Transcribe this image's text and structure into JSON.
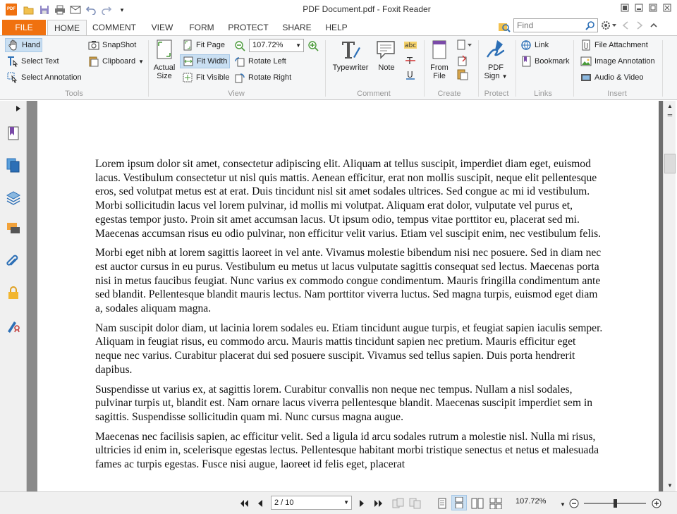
{
  "window": {
    "title": "PDF Document.pdf - Foxit Reader",
    "app_icon_text": "PDF"
  },
  "quick_access": [
    {
      "name": "open-icon"
    },
    {
      "name": "save-icon"
    },
    {
      "name": "print-icon"
    },
    {
      "name": "email-icon"
    },
    {
      "name": "undo-icon"
    },
    {
      "name": "redo-icon"
    },
    {
      "name": "customize-icon"
    }
  ],
  "tabs": {
    "file": "FILE",
    "home": "HOME",
    "comment": "COMMENT",
    "view": "VIEW",
    "form": "FORM",
    "protect": "PROTECT",
    "share": "SHARE",
    "help": "HELP"
  },
  "search": {
    "placeholder": "Find"
  },
  "ribbon": {
    "tools": {
      "hand": "Hand",
      "select_text": "Select Text",
      "select_annotation": "Select Annotation",
      "snapshot": "SnapShot",
      "clipboard": "Clipboard",
      "label": "Tools"
    },
    "view": {
      "actual_size_1": "Actual",
      "actual_size_2": "Size",
      "fit_page": "Fit Page",
      "fit_width": "Fit Width",
      "fit_visible": "Fit Visible",
      "zoom": "107.72%",
      "rotate_left": "Rotate Left",
      "rotate_right": "Rotate Right",
      "label": "View"
    },
    "comment": {
      "typewriter": "Typewriter",
      "note": "Note",
      "label": "Comment"
    },
    "create": {
      "from_file_1": "From",
      "from_file_2": "File",
      "label": "Create"
    },
    "protect": {
      "pdf_sign_1": "PDF",
      "pdf_sign_2": "Sign",
      "label": "Protect"
    },
    "links": {
      "link": "Link",
      "bookmark": "Bookmark",
      "label": "Links"
    },
    "insert": {
      "file_attachment": "File Attachment",
      "image_annotation": "Image Annotation",
      "audio_video": "Audio & Video",
      "label": "Insert"
    }
  },
  "document": {
    "paragraphs": [
      "Lorem ipsum dolor sit amet, consectetur adipiscing elit. Aliquam at tellus suscipit, imperdiet diam eget, euismod lacus. Vestibulum consectetur ut nisl quis mattis. Aenean efficitur, erat non mollis suscipit, neque elit pellentesque eros, sed volutpat metus est at erat. Duis tincidunt nisl sit amet sodales ultrices. Sed congue ac mi id vestibulum. Morbi sollicitudin lacus vel lorem pulvinar, id mollis mi volutpat. Aliquam erat dolor, vulputate vel purus et, egestas tempor justo. Proin sit amet accumsan lacus. Ut ipsum odio, tempus vitae porttitor eu, placerat sed mi. Maecenas accumsan risus eu odio pulvinar, non efficitur velit varius. Etiam vel suscipit enim, nec vestibulum felis.",
      "Morbi eget nibh at lorem sagittis laoreet in vel ante. Vivamus molestie bibendum nisi nec posuere. Sed in diam nec est auctor cursus in eu purus. Vestibulum eu metus ut lacus vulputate sagittis consequat sed lectus. Maecenas porta nisi in metus faucibus feugiat. Nunc varius ex commodo congue condimentum. Mauris fringilla condimentum ante sed blandit. Pellentesque blandit mauris lectus. Nam porttitor viverra luctus. Sed magna turpis, euismod eget diam a, sodales aliquam magna.",
      "Nam suscipit dolor diam, ut lacinia lorem sodales eu. Etiam tincidunt augue turpis, et feugiat sapien iaculis semper. Aliquam in feugiat risus, eu commodo arcu. Mauris mattis tincidunt sapien nec pretium. Mauris efficitur eget neque nec varius. Curabitur placerat dui sed posuere suscipit. Vivamus sed tellus sapien. Duis porta hendrerit dapibus.",
      "Suspendisse ut varius ex, at sagittis lorem. Curabitur convallis non neque nec tempus. Nullam a nisl sodales, pulvinar turpis ut, blandit est. Nam ornare lacus viverra pellentesque blandit. Maecenas suscipit imperdiet sem in sagittis. Suspendisse sollicitudin quam mi. Nunc cursus magna augue.",
      "Maecenas nec facilisis sapien, ac efficitur velit. Sed a ligula id arcu sodales rutrum a molestie nisl. Nulla mi risus, ultricies id enim in, scelerisque egestas lectus. Pellentesque habitant morbi tristique senectus et netus et malesuada fames ac turpis egestas. Fusce nisi augue, laoreet id felis eget, placerat"
    ]
  },
  "status_bar": {
    "page": "2 / 10",
    "zoom": "107.72%"
  },
  "colors": {
    "accent": "#f0710f",
    "ribbon_bg": "#f5f6f7",
    "selected": "#c9dff2"
  }
}
